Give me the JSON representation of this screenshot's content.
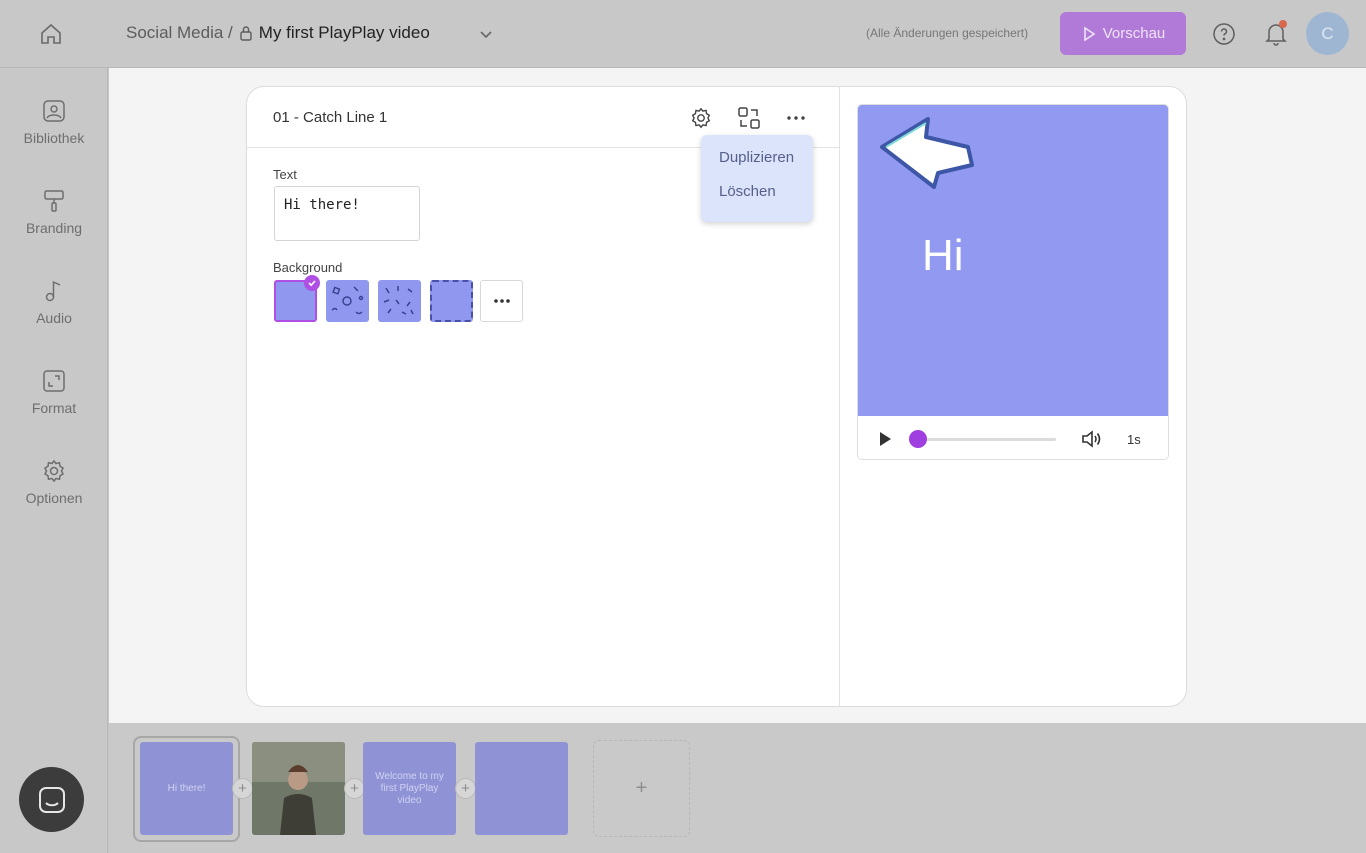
{
  "header": {
    "breadcrumb_section": "Social Media /",
    "project_title": "My first PlayPlay video",
    "saved_status": "(Alle Änderungen gespeichert)",
    "preview_label": "Vorschau",
    "avatar_initial": "C"
  },
  "sidebar": {
    "items": [
      {
        "label": "Bibliothek",
        "icon": "image-icon"
      },
      {
        "label": "Branding",
        "icon": "paint-roller-icon"
      },
      {
        "label": "Audio",
        "icon": "music-note-icon"
      },
      {
        "label": "Format",
        "icon": "resize-icon"
      },
      {
        "label": "Optionen",
        "icon": "gear-icon"
      }
    ]
  },
  "scene": {
    "title": "01 - Catch Line 1",
    "menu": {
      "duplicate": "Duplizieren",
      "delete": "Löschen"
    },
    "text_label": "Text",
    "text_value": "Hi there!",
    "background_label": "Background"
  },
  "preview": {
    "text": "Hi",
    "duration": "1s",
    "progress": 0.0,
    "canvas_color": "#9199f0"
  },
  "timeline": {
    "scenes": [
      {
        "label": "Hi there!"
      },
      {
        "label": ""
      },
      {
        "label": "Welcome to my first PlayPlay video"
      },
      {
        "label": ""
      }
    ],
    "add_symbol": "+"
  },
  "colors": {
    "accent": "#b04fe4",
    "preview_button": "#b27ad8"
  }
}
